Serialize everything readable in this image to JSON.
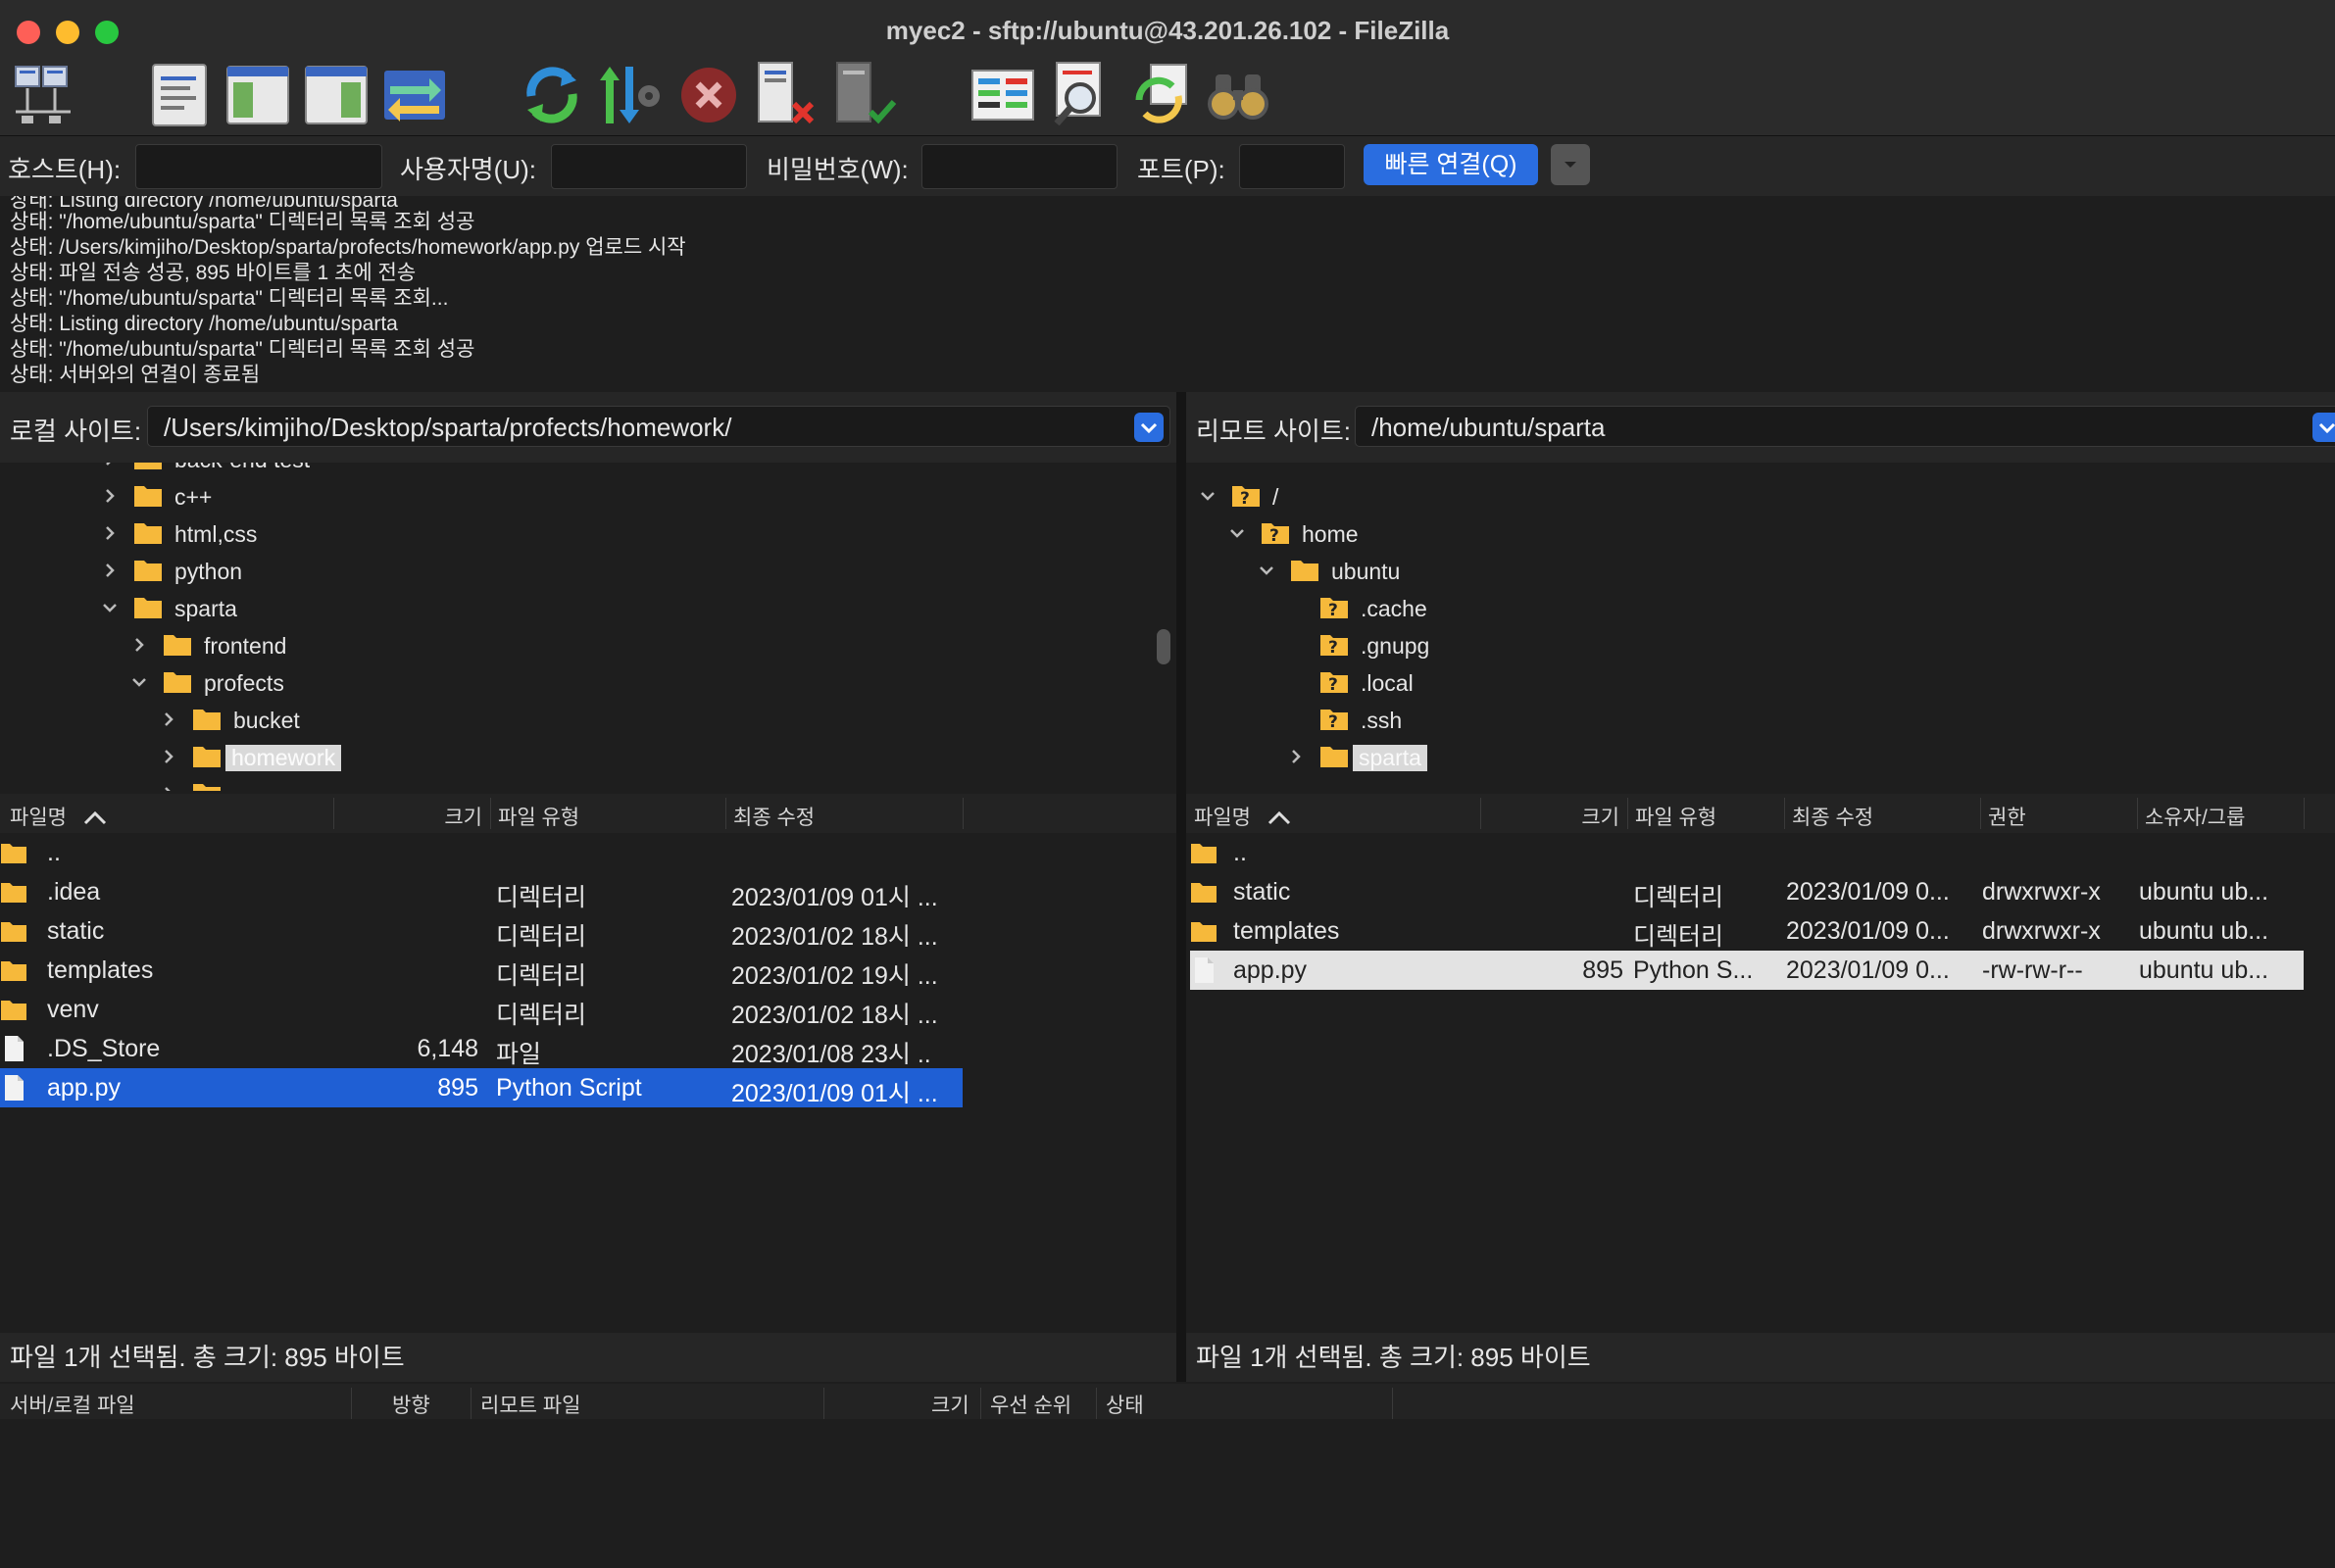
{
  "window": {
    "title": "myec2 - sftp://ubuntu@43.201.26.102 - FileZilla",
    "colors": {
      "close": "#fe5f57",
      "minimize": "#febc2e",
      "zoom": "#28c840",
      "accent": "#2a6de0",
      "folder": "#f6b93b"
    }
  },
  "toolbar": {
    "icons": [
      "site-manager-icon",
      "message-log-icon",
      "local-tree-icon",
      "remote-tree-icon",
      "transfer-queue-icon",
      "refresh-icon",
      "process-queue-icon",
      "cancel-icon",
      "disconnect-icon",
      "reconnect-icon",
      "directory-compare-icon",
      "filename-filter-icon",
      "sync-browse-icon",
      "search-icon"
    ]
  },
  "quickconnect": {
    "host_label": "호스트(H):",
    "user_label": "사용자명(U):",
    "pass_label": "비밀번호(W):",
    "port_label": "포트(P):",
    "button_label": "빠른 연결(Q)",
    "host_value": "",
    "user_value": "",
    "pass_value": "",
    "port_value": ""
  },
  "log": [
    "상태:  Listing directory /home/ubuntu/sparta",
    "상태:  \"/home/ubuntu/sparta\" 디렉터리 목록 조회 성공",
    "상태:  /Users/kimjiho/Desktop/sparta/profects/homework/app.py 업로드 시작",
    "상태:  파일 전송 성공, 895 바이트를 1 초에 전송",
    "상태:  \"/home/ubuntu/sparta\" 디렉터리 목록 조회...",
    "상태:  Listing directory /home/ubuntu/sparta",
    "상태:  \"/home/ubuntu/sparta\" 디렉터리 목록 조회 성공",
    "상태:  서버와의 연결이 종료됨"
  ],
  "local": {
    "site_label": "로컬 사이트:",
    "path": "/Users/kimjiho/Desktop/sparta/profects/homework/",
    "tree": [
      {
        "label": "back-end test",
        "expander": "right"
      },
      {
        "label": "c++",
        "expander": "right"
      },
      {
        "label": "html,css",
        "expander": "right"
      },
      {
        "label": "python",
        "expander": "right"
      },
      {
        "label": "sparta",
        "expander": "down"
      },
      {
        "label": "frontend",
        "expander": "right"
      },
      {
        "label": "profects",
        "expander": "down"
      },
      {
        "label": "bucket",
        "expander": "right"
      },
      {
        "label": "homework",
        "expander": "right",
        "selected": true
      },
      {
        "label": "",
        "expander": "right"
      }
    ],
    "columns": [
      "파일명",
      "크기",
      "파일 유형",
      "최종 수정"
    ],
    "files": [
      {
        "name": "..",
        "size": "",
        "type": "",
        "modified": "",
        "icon": "folder-icon"
      },
      {
        "name": ".idea",
        "size": "",
        "type": "디렉터리",
        "modified": "2023/01/09 01시 ...",
        "icon": "folder-icon"
      },
      {
        "name": "static",
        "size": "",
        "type": "디렉터리",
        "modified": "2023/01/02 18시 ...",
        "icon": "folder-icon"
      },
      {
        "name": "templates",
        "size": "",
        "type": "디렉터리",
        "modified": "2023/01/02 19시 ...",
        "icon": "folder-icon"
      },
      {
        "name": "venv",
        "size": "",
        "type": "디렉터리",
        "modified": "2023/01/02 18시 ...",
        "icon": "folder-icon"
      },
      {
        "name": ".DS_Store",
        "size": "6,148",
        "type": "파일",
        "modified": "2023/01/08 23시 ..",
        "icon": "file-icon"
      },
      {
        "name": "app.py",
        "size": "895",
        "type": "Python Script",
        "modified": "2023/01/09 01시 ...",
        "icon": "file-icon",
        "selected": true
      }
    ],
    "status": "파일 1개 선택됨. 총 크기: 895 바이트"
  },
  "remote": {
    "site_label": "리모트 사이트:",
    "path": "/home/ubuntu/sparta",
    "tree": [
      {
        "label": "/",
        "expander": "down",
        "unknown": true
      },
      {
        "label": "home",
        "expander": "down",
        "unknown": true
      },
      {
        "label": "ubuntu",
        "expander": "down",
        "unknown": false
      },
      {
        "label": ".cache",
        "expander": "",
        "unknown": true
      },
      {
        "label": ".gnupg",
        "expander": "",
        "unknown": true
      },
      {
        "label": ".local",
        "expander": "",
        "unknown": true
      },
      {
        "label": ".ssh",
        "expander": "",
        "unknown": true
      },
      {
        "label": "sparta",
        "expander": "right",
        "unknown": false,
        "selected": true
      }
    ],
    "columns": [
      "파일명",
      "크기",
      "파일 유형",
      "최종 수정",
      "권한",
      "소유자/그룹"
    ],
    "files": [
      {
        "name": "..",
        "size": "",
        "type": "",
        "modified": "",
        "perms": "",
        "owner": "",
        "icon": "folder-icon"
      },
      {
        "name": "static",
        "size": "",
        "type": "디렉터리",
        "modified": "2023/01/09 0...",
        "perms": "drwxrwxr-x",
        "owner": "ubuntu ub...",
        "icon": "folder-icon"
      },
      {
        "name": "templates",
        "size": "",
        "type": "디렉터리",
        "modified": "2023/01/09 0...",
        "perms": "drwxrwxr-x",
        "owner": "ubuntu ub...",
        "icon": "folder-icon"
      },
      {
        "name": "app.py",
        "size": "895",
        "type": "Python S...",
        "modified": "2023/01/09 0...",
        "perms": "-rw-rw-r--",
        "owner": "ubuntu ub...",
        "icon": "file-icon",
        "selected": true
      }
    ],
    "status": "파일 1개 선택됨. 총 크기: 895 바이트"
  },
  "queue": {
    "columns": [
      "서버/로컬 파일",
      "방향",
      "리모트 파일",
      "크기",
      "우선 순위",
      "상태"
    ]
  }
}
